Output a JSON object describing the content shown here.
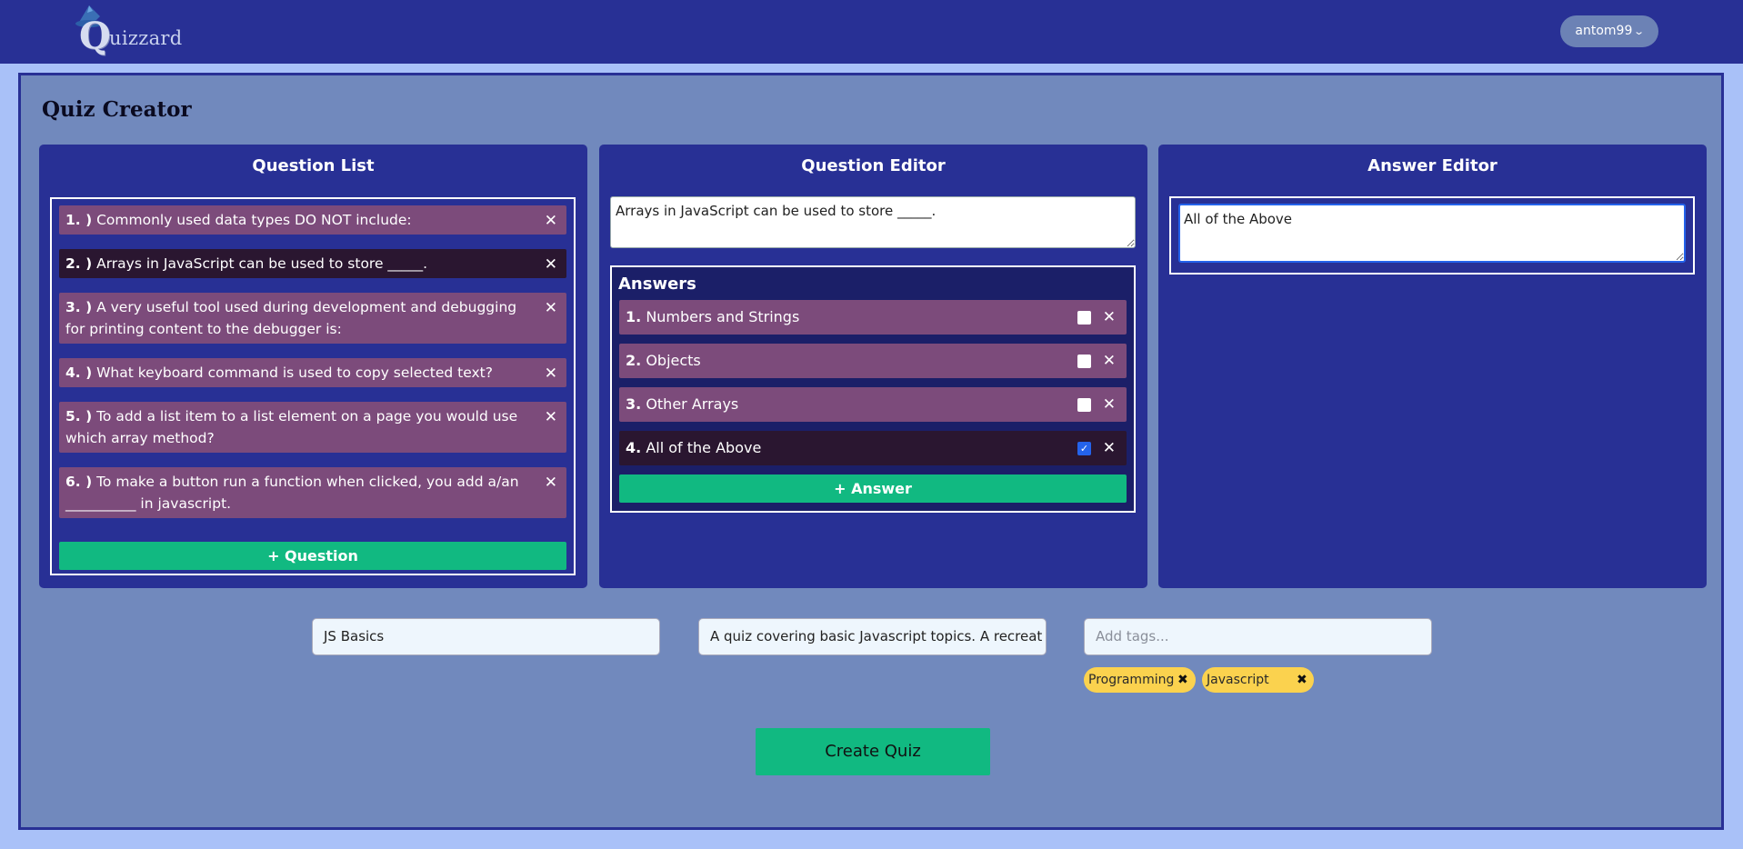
{
  "header": {
    "logo_text": "uizzard",
    "logo_letter": "Q",
    "user_label": "antom99",
    "user_chevron": "chevron-down"
  },
  "page": {
    "title": "Quiz Creator"
  },
  "question_list": {
    "title": "Question List",
    "questions": [
      {
        "num": "1. )",
        "text": "Commonly used data types DO NOT include:"
      },
      {
        "num": "2. )",
        "text": "Arrays in JavaScript can be used to store _____."
      },
      {
        "num": "3. )",
        "text": "A very useful tool used during development and debugging for printing content to the debugger is:"
      },
      {
        "num": "4. )",
        "text": "What keyboard command is used to copy selected text?"
      },
      {
        "num": "5. )",
        "text": "To add a list item to a list element on a page you would use which array method?"
      },
      {
        "num": "6. )",
        "text": "To make a button run a function when clicked, you add a/an __________ in javascript."
      }
    ],
    "selected_index": 1,
    "add_label": "+ Question"
  },
  "question_editor": {
    "title": "Question Editor",
    "question_text": "Arrays in JavaScript can be used to store _____.",
    "answers_title": "Answers",
    "answers": [
      {
        "num": "1.",
        "text": "Numbers and Strings",
        "correct": false
      },
      {
        "num": "2.",
        "text": "Objects",
        "correct": false
      },
      {
        "num": "3.",
        "text": "Other Arrays",
        "correct": false
      },
      {
        "num": "4.",
        "text": "All of the Above",
        "correct": true
      }
    ],
    "selected_answer_index": 3,
    "add_label": "+ Answer"
  },
  "answer_editor": {
    "title": "Answer Editor",
    "answer_text": "All of the Above"
  },
  "quiz_meta": {
    "name_value": "JS Basics",
    "description_value": "A quiz covering basic Javascript topics. A recreat",
    "tags_placeholder": "Add tags...",
    "tags": [
      "Programming",
      "Javascript"
    ]
  },
  "create_label": "Create Quiz",
  "colors": {
    "navy": "#283095",
    "panel_bg": "#7189bd",
    "item_purple": "#7c4b7b",
    "item_selected": "#2a1630",
    "green": "#11b981",
    "tag_yellow": "#fbd24e"
  }
}
